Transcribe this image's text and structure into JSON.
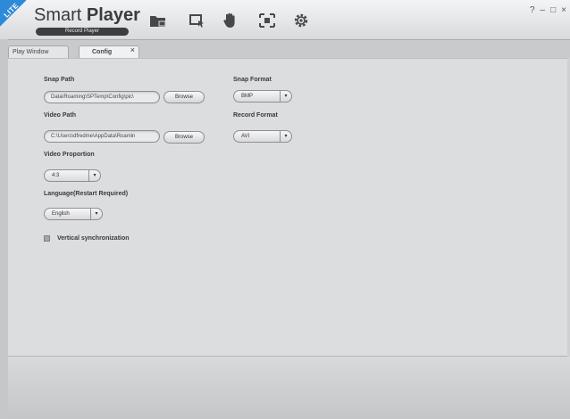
{
  "app": {
    "badge": "LITE",
    "title_light": "Smart",
    "title_bold": "Player",
    "subtitle": "Record Player",
    "window_controls": [
      "?",
      "–",
      "□",
      "×"
    ]
  },
  "toolbar": {
    "icons": [
      "folder-camera-icon",
      "cursor-window-icon",
      "hand-icon",
      "fullscreen-icon",
      "gear-icon"
    ]
  },
  "tabs": [
    {
      "label": "Play Window",
      "active": false
    },
    {
      "label": "Config",
      "active": true,
      "close": "×"
    }
  ],
  "config": {
    "snap_path": {
      "label": "Snap Path",
      "value": "Data\\Roaming\\SPTemp\\Config\\pic\\",
      "browse_label": "Browse"
    },
    "video_path": {
      "label": "Video Path",
      "value": "C:\\Users\\dfredme\\AppData\\Roamin",
      "browse_label": "Browse"
    },
    "snap_format": {
      "label": "Snap Format",
      "value": "BMP"
    },
    "record_format": {
      "label": "Record Format",
      "value": "AVI"
    },
    "video_proportion": {
      "label": "Video Proportion",
      "value": "4:3"
    },
    "language": {
      "label": "Language(Restart Required)",
      "value": "English"
    },
    "vsync": {
      "label": "Vertical synchronization",
      "checked": false
    }
  },
  "colors": {
    "accent": "#2d8ad8",
    "panel": "#dcdddf",
    "title_bar": "#e6e7e9"
  }
}
